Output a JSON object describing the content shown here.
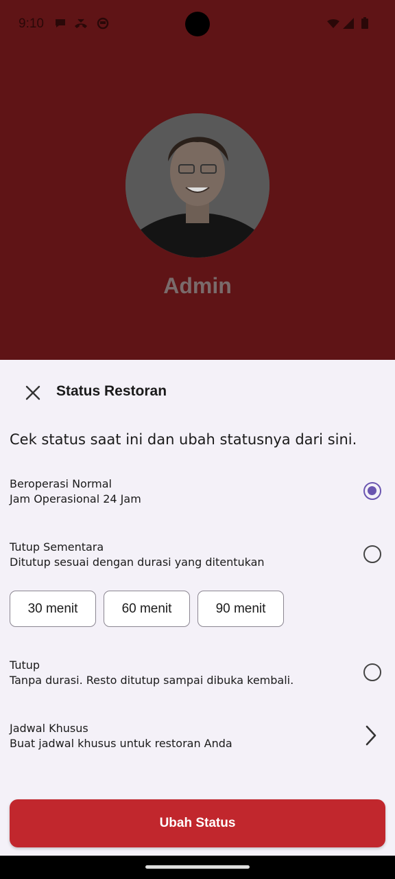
{
  "status_bar": {
    "time": "9:10"
  },
  "background": {
    "profile_name": "Admin"
  },
  "sheet": {
    "title": "Status Restoran",
    "description": "Cek status saat ini dan ubah statusnya dari sini.",
    "options": [
      {
        "title": "Beroperasi Normal",
        "subtitle": "Jam Operasional 24 Jam",
        "selected": true
      },
      {
        "title": "Tutup Sementara",
        "subtitle": "Ditutup sesuai dengan durasi yang ditentukan",
        "selected": false
      },
      {
        "title": "Tutup",
        "subtitle": "Tanpa durasi. Resto ditutup sampai dibuka kembali.",
        "selected": false
      },
      {
        "title": "Jadwal Khusus",
        "subtitle": "Buat jadwal khusus untuk restoran Anda"
      }
    ],
    "durations": [
      "30 menit",
      "60 menit",
      "90 menit"
    ],
    "submit_label": "Ubah Status"
  },
  "colors": {
    "accent": "#6a55b0",
    "primary_button": "#c1272d",
    "background_dim": "#5f1416"
  }
}
